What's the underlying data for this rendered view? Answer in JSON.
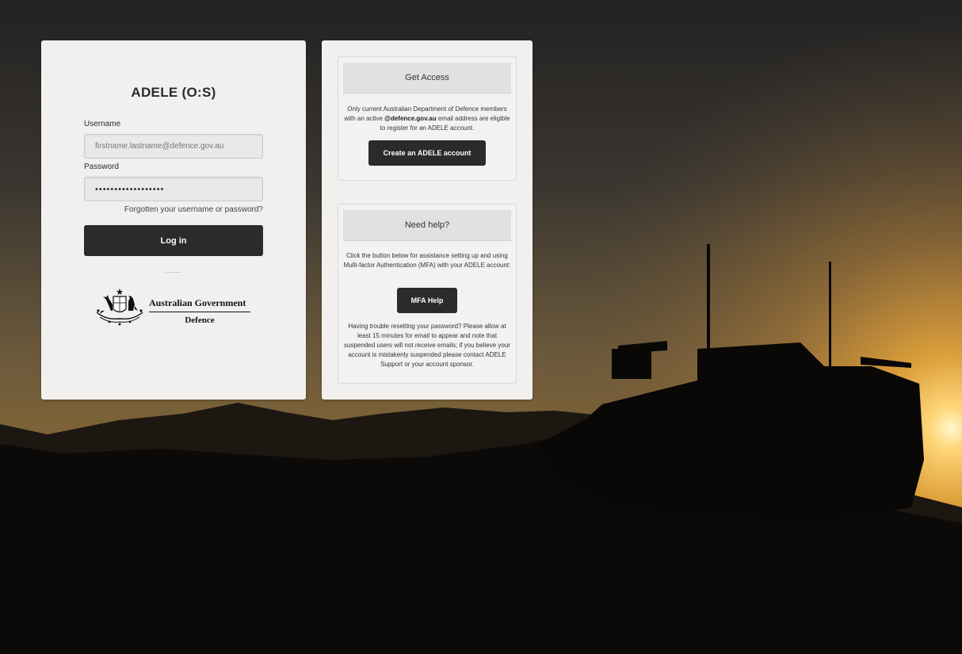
{
  "login": {
    "title": "ADELE (O:S)",
    "username_label": "Username",
    "username_placeholder": "firstname.lastname@defence.gov.au",
    "password_label": "Password",
    "password_value": "••••••••••••••••••",
    "forgot_link": "Forgotten your username or password?",
    "login_button": "Log in",
    "logo": {
      "government_text": "Australian Government",
      "department_text": "Defence",
      "icon": "commonwealth-coat-of-arms-icon"
    }
  },
  "get_access": {
    "heading": "Get Access",
    "text_before": "Only current Australian Department of Defence members with an active ",
    "text_bold": "@defence.gov.au",
    "text_after": " email address are eligible to register for an ADELE account.",
    "button": "Create an ADELE account"
  },
  "need_help": {
    "heading": "Need help?",
    "intro": "Click the button below for assistance setting up and using Multi-factor Authentication (MFA) with your ADELE account:",
    "button": "MFA Help",
    "trouble_text": "Having trouble resetting your password? Please allow at least 15 minutes for email to appear and note that suspended users will not receive emails; if you believe your account is mistakenly suspended please contact ADELE Support or your account sponsor."
  },
  "colors": {
    "panel_bg": "#f1f0ef",
    "button_bg": "#2b2b2b",
    "header_bg": "#dfe1e2",
    "sunset_glow": "#fff3c4"
  }
}
